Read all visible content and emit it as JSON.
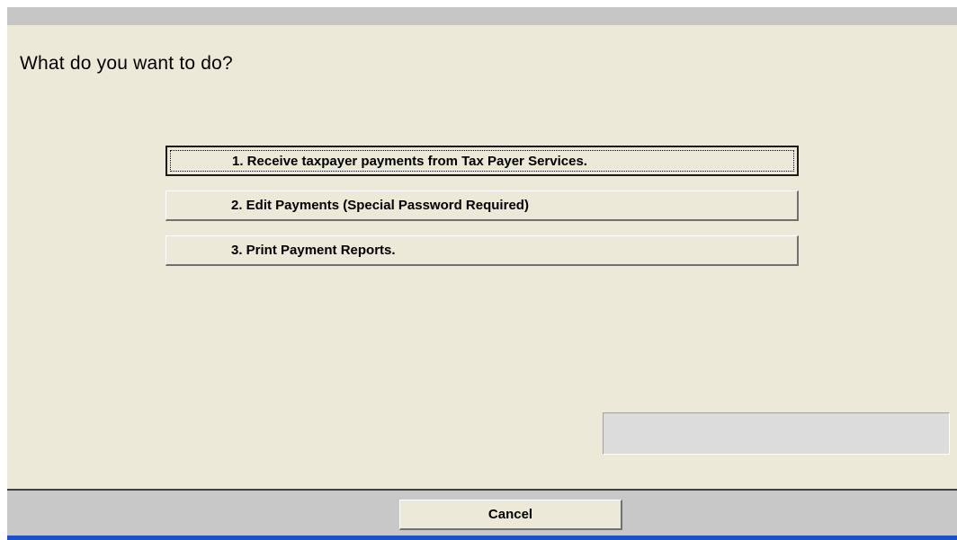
{
  "dialog": {
    "prompt": "What do you want to do?",
    "options": [
      {
        "label": "1. Receive taxpayer payments from Tax Payer Services."
      },
      {
        "label": "2. Edit Payments (Special Password Required)"
      },
      {
        "label": "3. Print Payment Reports."
      }
    ],
    "cancel_label": "Cancel"
  },
  "colors": {
    "panel_background": "#ece9d8",
    "bar_gray": "#c8c8c8",
    "accent_blue": "#1c4fcf"
  }
}
